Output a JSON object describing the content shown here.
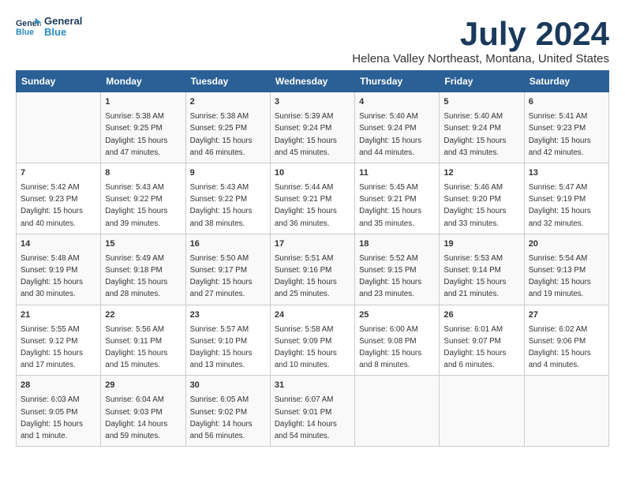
{
  "logo": {
    "line1": "General",
    "line2": "Blue"
  },
  "header": {
    "month_year": "July 2024",
    "location": "Helena Valley Northeast, Montana, United States"
  },
  "weekdays": [
    "Sunday",
    "Monday",
    "Tuesday",
    "Wednesday",
    "Thursday",
    "Friday",
    "Saturday"
  ],
  "weeks": [
    [
      {
        "day": "",
        "content": ""
      },
      {
        "day": "1",
        "content": "Sunrise: 5:38 AM\nSunset: 9:25 PM\nDaylight: 15 hours\nand 47 minutes."
      },
      {
        "day": "2",
        "content": "Sunrise: 5:38 AM\nSunset: 9:25 PM\nDaylight: 15 hours\nand 46 minutes."
      },
      {
        "day": "3",
        "content": "Sunrise: 5:39 AM\nSunset: 9:24 PM\nDaylight: 15 hours\nand 45 minutes."
      },
      {
        "day": "4",
        "content": "Sunrise: 5:40 AM\nSunset: 9:24 PM\nDaylight: 15 hours\nand 44 minutes."
      },
      {
        "day": "5",
        "content": "Sunrise: 5:40 AM\nSunset: 9:24 PM\nDaylight: 15 hours\nand 43 minutes."
      },
      {
        "day": "6",
        "content": "Sunrise: 5:41 AM\nSunset: 9:23 PM\nDaylight: 15 hours\nand 42 minutes."
      }
    ],
    [
      {
        "day": "7",
        "content": "Sunrise: 5:42 AM\nSunset: 9:23 PM\nDaylight: 15 hours\nand 40 minutes."
      },
      {
        "day": "8",
        "content": "Sunrise: 5:43 AM\nSunset: 9:22 PM\nDaylight: 15 hours\nand 39 minutes."
      },
      {
        "day": "9",
        "content": "Sunrise: 5:43 AM\nSunset: 9:22 PM\nDaylight: 15 hours\nand 38 minutes."
      },
      {
        "day": "10",
        "content": "Sunrise: 5:44 AM\nSunset: 9:21 PM\nDaylight: 15 hours\nand 36 minutes."
      },
      {
        "day": "11",
        "content": "Sunrise: 5:45 AM\nSunset: 9:21 PM\nDaylight: 15 hours\nand 35 minutes."
      },
      {
        "day": "12",
        "content": "Sunrise: 5:46 AM\nSunset: 9:20 PM\nDaylight: 15 hours\nand 33 minutes."
      },
      {
        "day": "13",
        "content": "Sunrise: 5:47 AM\nSunset: 9:19 PM\nDaylight: 15 hours\nand 32 minutes."
      }
    ],
    [
      {
        "day": "14",
        "content": "Sunrise: 5:48 AM\nSunset: 9:19 PM\nDaylight: 15 hours\nand 30 minutes."
      },
      {
        "day": "15",
        "content": "Sunrise: 5:49 AM\nSunset: 9:18 PM\nDaylight: 15 hours\nand 28 minutes."
      },
      {
        "day": "16",
        "content": "Sunrise: 5:50 AM\nSunset: 9:17 PM\nDaylight: 15 hours\nand 27 minutes."
      },
      {
        "day": "17",
        "content": "Sunrise: 5:51 AM\nSunset: 9:16 PM\nDaylight: 15 hours\nand 25 minutes."
      },
      {
        "day": "18",
        "content": "Sunrise: 5:52 AM\nSunset: 9:15 PM\nDaylight: 15 hours\nand 23 minutes."
      },
      {
        "day": "19",
        "content": "Sunrise: 5:53 AM\nSunset: 9:14 PM\nDaylight: 15 hours\nand 21 minutes."
      },
      {
        "day": "20",
        "content": "Sunrise: 5:54 AM\nSunset: 9:13 PM\nDaylight: 15 hours\nand 19 minutes."
      }
    ],
    [
      {
        "day": "21",
        "content": "Sunrise: 5:55 AM\nSunset: 9:12 PM\nDaylight: 15 hours\nand 17 minutes."
      },
      {
        "day": "22",
        "content": "Sunrise: 5:56 AM\nSunset: 9:11 PM\nDaylight: 15 hours\nand 15 minutes."
      },
      {
        "day": "23",
        "content": "Sunrise: 5:57 AM\nSunset: 9:10 PM\nDaylight: 15 hours\nand 13 minutes."
      },
      {
        "day": "24",
        "content": "Sunrise: 5:58 AM\nSunset: 9:09 PM\nDaylight: 15 hours\nand 10 minutes."
      },
      {
        "day": "25",
        "content": "Sunrise: 6:00 AM\nSunset: 9:08 PM\nDaylight: 15 hours\nand 8 minutes."
      },
      {
        "day": "26",
        "content": "Sunrise: 6:01 AM\nSunset: 9:07 PM\nDaylight: 15 hours\nand 6 minutes."
      },
      {
        "day": "27",
        "content": "Sunrise: 6:02 AM\nSunset: 9:06 PM\nDaylight: 15 hours\nand 4 minutes."
      }
    ],
    [
      {
        "day": "28",
        "content": "Sunrise: 6:03 AM\nSunset: 9:05 PM\nDaylight: 15 hours\nand 1 minute."
      },
      {
        "day": "29",
        "content": "Sunrise: 6:04 AM\nSunset: 9:03 PM\nDaylight: 14 hours\nand 59 minutes."
      },
      {
        "day": "30",
        "content": "Sunrise: 6:05 AM\nSunset: 9:02 PM\nDaylight: 14 hours\nand 56 minutes."
      },
      {
        "day": "31",
        "content": "Sunrise: 6:07 AM\nSunset: 9:01 PM\nDaylight: 14 hours\nand 54 minutes."
      },
      {
        "day": "",
        "content": ""
      },
      {
        "day": "",
        "content": ""
      },
      {
        "day": "",
        "content": ""
      }
    ]
  ]
}
